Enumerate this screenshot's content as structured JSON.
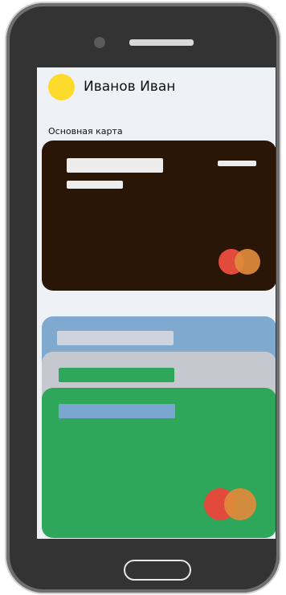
{
  "header": {
    "user_name": "Иванов Иван",
    "avatar_color": "#fddb2d"
  },
  "main_section": {
    "label": "Основная карта"
  },
  "cards": [
    {
      "id": "primary",
      "background": "#2a1607",
      "brand": "mastercard-logo"
    },
    {
      "id": "blue",
      "background": "#80a9d0"
    },
    {
      "id": "gray",
      "background": "#c5c8cf"
    },
    {
      "id": "green",
      "background": "#2fa75b",
      "brand": "mastercard-logo"
    }
  ],
  "colors": {
    "screen_bg": "#eef1f6",
    "phone_body": "#333333",
    "mastercard_red": "#e24a3b",
    "mastercard_orange": "#e08b3b"
  },
  "icons": [
    "camera-icon",
    "speaker-icon",
    "home-button-icon",
    "mastercard-logo"
  ]
}
